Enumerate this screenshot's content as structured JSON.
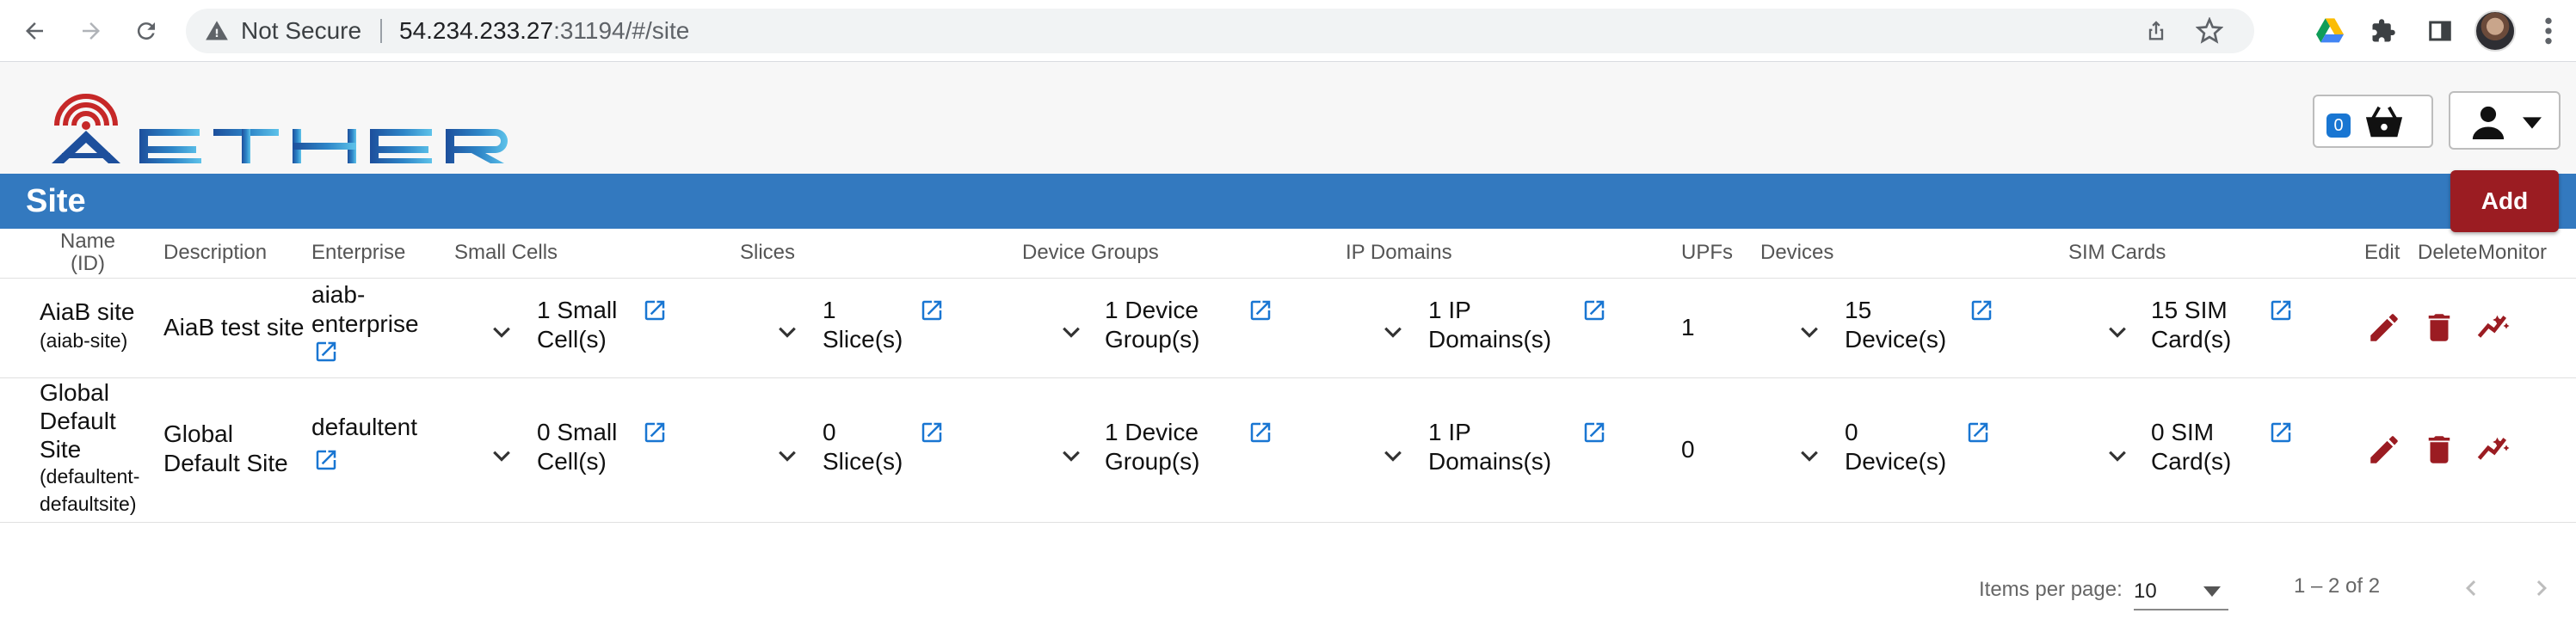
{
  "browser": {
    "security_label": "Not Secure",
    "url_host": "54.234.233.27",
    "url_rest": ":31194/#/site"
  },
  "header": {
    "logo_text": "AETHER",
    "cart_count": "0"
  },
  "page": {
    "title": "Site",
    "add_label": "Add"
  },
  "table": {
    "columns": {
      "name": "Name\n(ID)",
      "description": "Description",
      "enterprise": "Enterprise",
      "small_cells": "Small Cells",
      "slices": "Slices",
      "device_groups": "Device Groups",
      "ip_domains": "IP Domains",
      "upfs": "UPFs",
      "devices": "Devices",
      "sim_cards": "SIM Cards",
      "edit": "Edit",
      "delete": "Delete",
      "monitor": "Monitor"
    },
    "rows": [
      {
        "name": "AiaB site",
        "id": "(aiab-site)",
        "description": "AiaB test site",
        "enterprise": "aiab-\nenterprise",
        "small_cells": "1 Small\nCell(s)",
        "slices": "1\nSlice(s)",
        "device_groups": "1 Device\nGroup(s)",
        "ip_domains": "1 IP\nDomains(s)",
        "upfs": "1",
        "devices": "15\nDevice(s)",
        "sim_cards": "15 SIM\nCard(s)"
      },
      {
        "name": "Global\nDefault\nSite",
        "id": "(defaultent-\ndefaultsite)",
        "description": "Global\nDefault Site",
        "enterprise": "defaultent",
        "small_cells": "0 Small\nCell(s)",
        "slices": "0\nSlice(s)",
        "device_groups": "1 Device\nGroup(s)",
        "ip_domains": "1 IP\nDomains(s)",
        "upfs": "0",
        "devices": "0\nDevice(s)",
        "sim_cards": "0 SIM\nCard(s)"
      }
    ]
  },
  "paginator": {
    "items_per_page_label": "Items per page:",
    "page_size": "10",
    "range_label": "1 – 2 of 2"
  },
  "colors": {
    "title_bar": "#3379bf",
    "add_button": "#9b1c22",
    "action_icons": "#9b1c22",
    "link_icons": "#1976d2"
  }
}
